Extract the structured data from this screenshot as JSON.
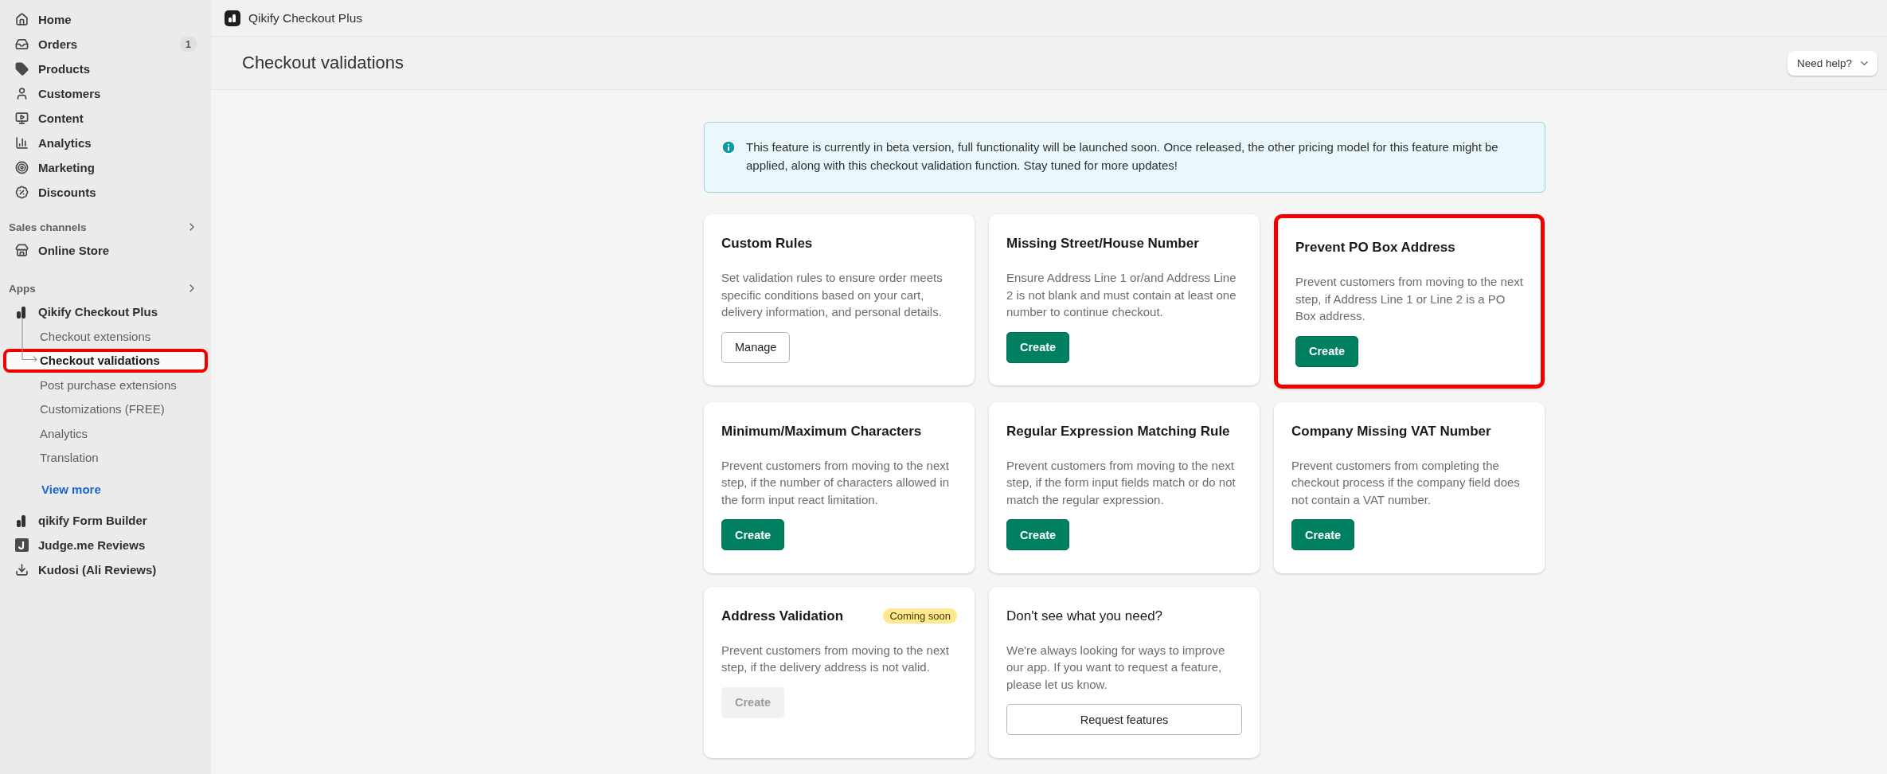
{
  "top_bar": {
    "app_name": "Qikify Checkout Plus"
  },
  "sidebar": {
    "nav": [
      {
        "label": "Home"
      },
      {
        "label": "Orders",
        "badge": "1"
      },
      {
        "label": "Products"
      },
      {
        "label": "Customers"
      },
      {
        "label": "Content"
      },
      {
        "label": "Analytics"
      },
      {
        "label": "Marketing"
      },
      {
        "label": "Discounts"
      }
    ],
    "sales_channels": {
      "title": "Sales channels",
      "items": [
        {
          "label": "Online Store"
        }
      ]
    },
    "apps": {
      "title": "Apps",
      "items": [
        {
          "label": "Qikify Checkout Plus",
          "children": [
            {
              "label": "Checkout extensions",
              "selected": false,
              "highlighted": false
            },
            {
              "label": "Checkout validations",
              "selected": true,
              "highlighted": true
            },
            {
              "label": "Post purchase extensions",
              "selected": false,
              "highlighted": false
            },
            {
              "label": "Customizations (FREE)",
              "selected": false,
              "highlighted": false
            },
            {
              "label": "Analytics",
              "selected": false,
              "highlighted": false
            },
            {
              "label": "Translation",
              "selected": false,
              "highlighted": false
            }
          ],
          "view_more": "View more"
        },
        {
          "label": "qikify Form Builder"
        },
        {
          "label": "Judge.me Reviews"
        },
        {
          "label": "Kudosi (Ali Reviews)"
        }
      ]
    }
  },
  "page": {
    "title": "Checkout validations",
    "help_button": "Need help?"
  },
  "banner": {
    "text": "This feature is currently in beta version, full functionality will be launched soon. Once released, the other pricing model for this feature might be applied, along with this checkout validation function. Stay tuned for more updates!"
  },
  "cards": [
    {
      "kind": "feature",
      "title": "Custom Rules",
      "description": "Set validation rules to ensure order meets specific conditions based on your cart, delivery information, and personal details.",
      "button": {
        "label": "Manage",
        "kind": "secondary"
      },
      "highlighted": false
    },
    {
      "kind": "feature",
      "title": "Missing Street/House Number",
      "description": "Ensure Address Line 1 or/and Address Line 2 is not blank and must contain at least one number to continue checkout.",
      "button": {
        "label": "Create",
        "kind": "primary"
      },
      "highlighted": false
    },
    {
      "kind": "feature",
      "title": "Prevent PO Box Address",
      "description": "Prevent customers from moving to the next step, if Address Line 1 or Line 2 is a PO Box address.",
      "button": {
        "label": "Create",
        "kind": "primary"
      },
      "highlighted": true
    },
    {
      "kind": "feature",
      "title": "Minimum/Maximum Characters",
      "description": "Prevent customers from moving to the next step, if the number of characters allowed in the form input react limitation.",
      "button": {
        "label": "Create",
        "kind": "primary"
      },
      "highlighted": false
    },
    {
      "kind": "feature",
      "title": "Regular Expression Matching Rule",
      "description": "Prevent customers from moving to the next step, if the form input fields match or do not match the regular expression.",
      "button": {
        "label": "Create",
        "kind": "primary"
      },
      "highlighted": false
    },
    {
      "kind": "feature",
      "title": "Company Missing VAT Number",
      "description": "Prevent customers from completing the checkout process if the company field does not contain a VAT number.",
      "button": {
        "label": "Create",
        "kind": "primary"
      },
      "highlighted": false
    },
    {
      "kind": "feature",
      "title": "Address Validation",
      "badge": "Coming soon",
      "description": "Prevent customers from moving to the next step, if the delivery address is not valid.",
      "button": {
        "label": "Create",
        "kind": "disabled"
      },
      "highlighted": false
    },
    {
      "kind": "request",
      "title": "Don't see what you need?",
      "description": "We're always looking for ways to improve our app. If you want to request a feature, please let us know.",
      "button": {
        "label": "Request features",
        "kind": "wide"
      },
      "highlighted": false
    }
  ]
}
